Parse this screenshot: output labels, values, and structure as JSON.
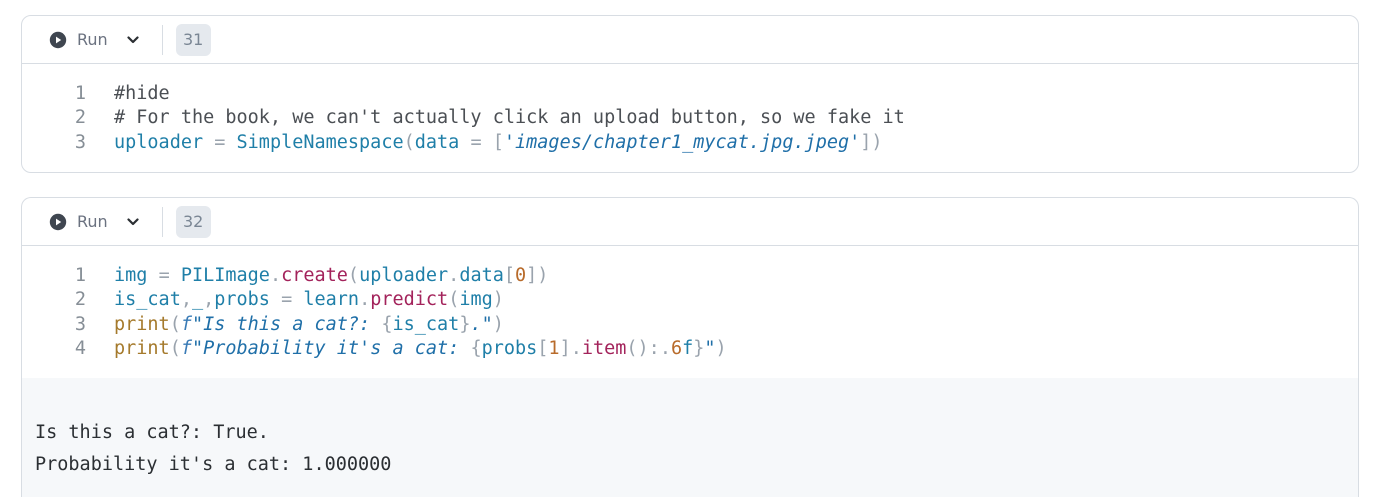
{
  "run_label": "Run",
  "cells": [
    {
      "exec_count": "31",
      "lines": [
        [
          "1",
          "#hide"
        ],
        [
          "2",
          "# For the book, we can't actually click an upload button, so we fake it"
        ],
        [
          "3",
          "uploader = SimpleNamespace(data = ['images/chapter1_mycat.jpg.jpeg'])"
        ]
      ]
    },
    {
      "exec_count": "32",
      "lines": [
        [
          "1",
          "img = PILImage.create(uploader.data[0])"
        ],
        [
          "2",
          "is_cat,_,probs = learn.predict(img)"
        ],
        [
          "3",
          "print(f\"Is this a cat?: {is_cat}.\")"
        ],
        [
          "4",
          "print(f\"Probability it's a cat: {probs[1].item():.6f}\")"
        ]
      ],
      "output": [
        "Is this a cat?: True.",
        "Probability it's a cat: 1.000000"
      ]
    }
  ]
}
